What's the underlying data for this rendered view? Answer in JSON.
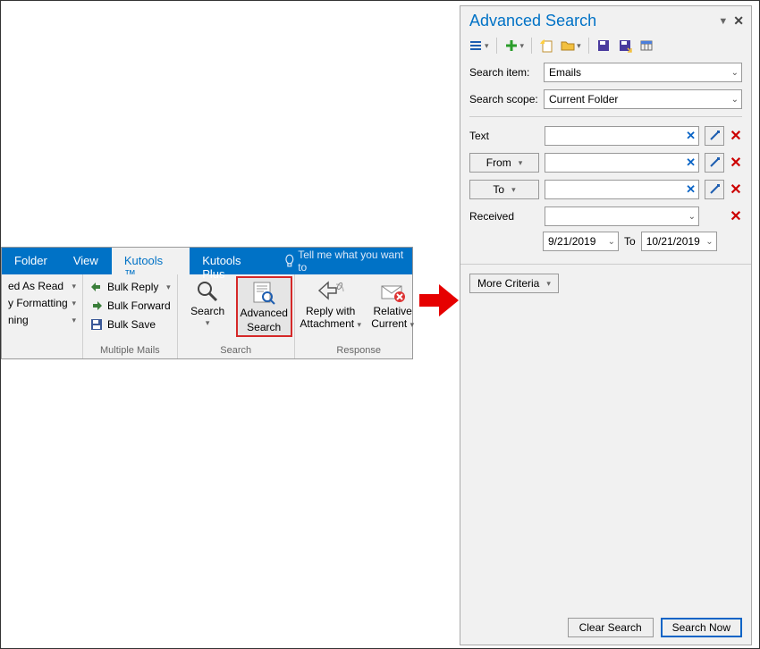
{
  "ribbon": {
    "tabs": [
      "Folder",
      "View",
      "Kutools ™",
      "Kutools Plus"
    ],
    "active_tab_index": 2,
    "tell_me": "Tell me what you want to",
    "groups": {
      "misc": {
        "items": [
          {
            "label": "ed As Read",
            "has_caret": true
          },
          {
            "label": "y Formatting",
            "has_caret": true
          },
          {
            "label": "ning",
            "has_caret": true
          }
        ]
      },
      "multiple_mails": {
        "label": "Multiple Mails",
        "items": [
          {
            "label": "Bulk Reply",
            "has_caret": true
          },
          {
            "label": "Bulk Forward",
            "has_caret": false
          },
          {
            "label": "Bulk Save",
            "has_caret": false
          }
        ]
      },
      "search": {
        "label": "Search",
        "items": [
          {
            "label1": "Search",
            "label2": "",
            "has_caret": true
          },
          {
            "label1": "Advanced",
            "label2": "Search",
            "has_caret": false
          }
        ]
      },
      "response": {
        "label": "Response",
        "items": [
          {
            "label1": "Reply with",
            "label2": "Attachment",
            "has_caret": true
          },
          {
            "label1": "Relative",
            "label2": "Current",
            "has_caret": true
          }
        ]
      }
    }
  },
  "pane": {
    "title": "Advanced Search",
    "search_item_label": "Search item:",
    "search_item_value": "Emails",
    "search_scope_label": "Search scope:",
    "search_scope_value": "Current Folder",
    "criteria": {
      "text_label": "Text",
      "from_label": "From",
      "to_label": "To",
      "received_label": "Received",
      "date_from": "9/21/2019",
      "date_to_word": "To",
      "date_to": "10/21/2019"
    },
    "more_criteria": "More Criteria",
    "clear_search": "Clear Search",
    "search_now": "Search Now"
  },
  "icons": {
    "bulb": "bulb",
    "caret": "▾",
    "caret_small": "▾"
  }
}
